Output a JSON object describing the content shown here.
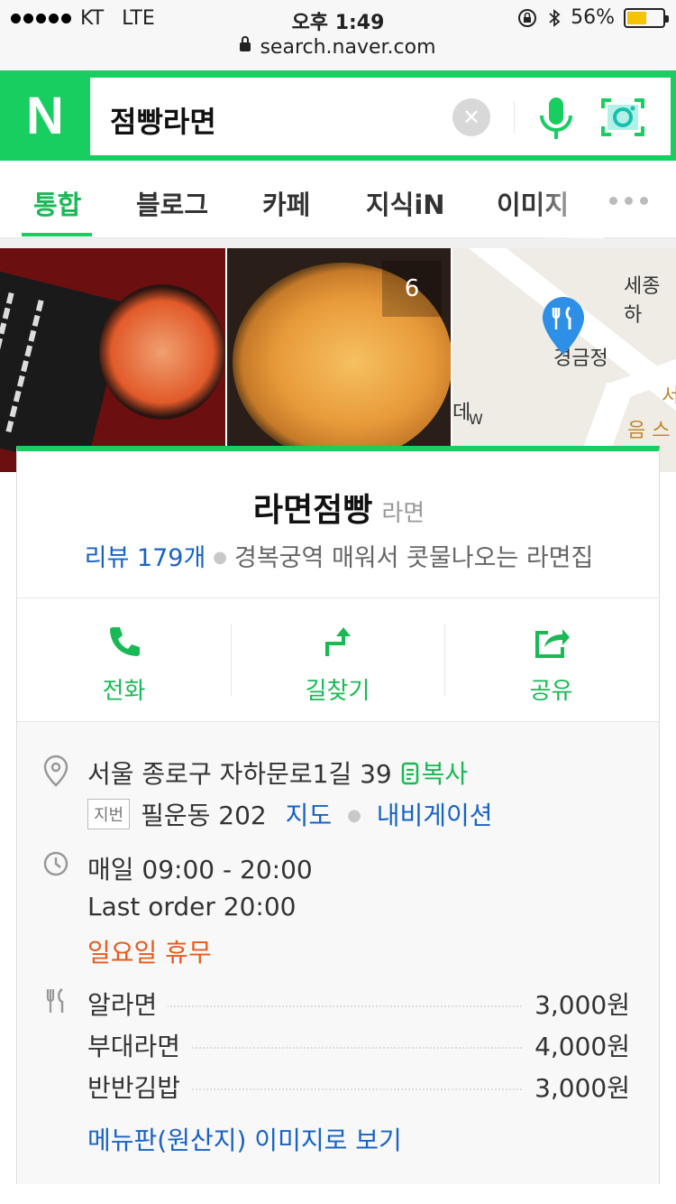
{
  "status": {
    "carrier": "KT",
    "network": "LTE",
    "time": "오후 1:49",
    "battery": "56%",
    "battery_level": 0.56
  },
  "browser": {
    "url": "search.naver.com"
  },
  "search": {
    "logo": "N",
    "query": "점빵라면"
  },
  "tabs": [
    {
      "label": "통합",
      "active": true
    },
    {
      "label": "블로그"
    },
    {
      "label": "카페"
    },
    {
      "label": "지식iN"
    },
    {
      "label": "이미지"
    }
  ],
  "photos": {
    "count": "6"
  },
  "map": {
    "labels": [
      "세종하",
      "경금정",
      "서",
      "음 스",
      "데",
      "W"
    ]
  },
  "place": {
    "name": "라면점빵",
    "category": "라면",
    "review": "리뷰 179개",
    "description": "경복궁역 매워서 콧물나오는 라면집"
  },
  "actions": [
    {
      "label": "전화",
      "icon": "phone-icon"
    },
    {
      "label": "길찾기",
      "icon": "directions-icon"
    },
    {
      "label": "공유",
      "icon": "share-icon"
    }
  ],
  "address": {
    "road": "서울 종로구 자하문로1길 39",
    "copy": "복사",
    "jibun_tag": "지번",
    "jibun": "필운동 202",
    "map_link": "지도",
    "navi_link": "내비게이션"
  },
  "hours": {
    "daily": "매일 09:00 - 20:00",
    "last_order": "Last order 20:00",
    "holiday": "일요일 휴무"
  },
  "menu": {
    "items": [
      {
        "name": "알라면",
        "price": "3,000원"
      },
      {
        "name": "부대라면",
        "price": "4,000원"
      },
      {
        "name": "반반김밥",
        "price": "3,000원"
      }
    ],
    "link": "메뉴판(원산지) 이미지로 보기"
  },
  "colors": {
    "naver_green": "#19ce60",
    "link_blue": "#1863c4",
    "holiday_orange": "#e65a1d"
  }
}
